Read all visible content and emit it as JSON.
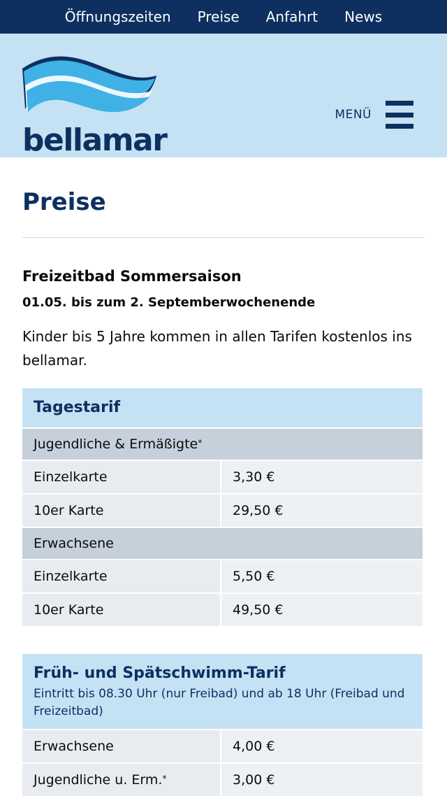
{
  "topnav": {
    "items": [
      "Öffnungszeiten",
      "Preise",
      "Anfahrt",
      "News"
    ]
  },
  "header": {
    "logo_text": "bellamar",
    "menu_label": "MENÜ"
  },
  "page": {
    "title": "Preise",
    "section_title": "Freizeitbad Sommersaison",
    "section_subtitle": "01.05. bis zum 2. Septemberwochenende",
    "intro": "Kinder bis 5 Jahre kommen in allen Tarifen kostenlos ins bellamar."
  },
  "table1": {
    "title": "Tagestarif",
    "groups": [
      {
        "label": "Jugendliche & Ermäßigte",
        "mark": "*",
        "rows": [
          {
            "label": "Einzelkarte",
            "price": "3,30 €"
          },
          {
            "label": "10er Karte",
            "price": "29,50 €"
          }
        ]
      },
      {
        "label": "Erwachsene",
        "mark": "",
        "rows": [
          {
            "label": "Einzelkarte",
            "price": "5,50 €"
          },
          {
            "label": "10er Karte",
            "price": "49,50 €"
          }
        ]
      }
    ]
  },
  "table2": {
    "title": "Früh- und Spätschwimm-Tarif",
    "subtitle": "Eintritt bis 08.30 Uhr (nur Freibad) und ab 18 Uhr (Freibad und Freizeitbad)",
    "rows": [
      {
        "label": "Erwachsene",
        "mark": "",
        "price": "4,00 €"
      },
      {
        "label": "Jugendliche u. Erm.",
        "mark": "*",
        "price": "3,00 €"
      }
    ]
  },
  "colors": {
    "navy": "#0d3061",
    "light_blue": "#c5e2f4",
    "wave_blue": "#3fb1e5"
  }
}
